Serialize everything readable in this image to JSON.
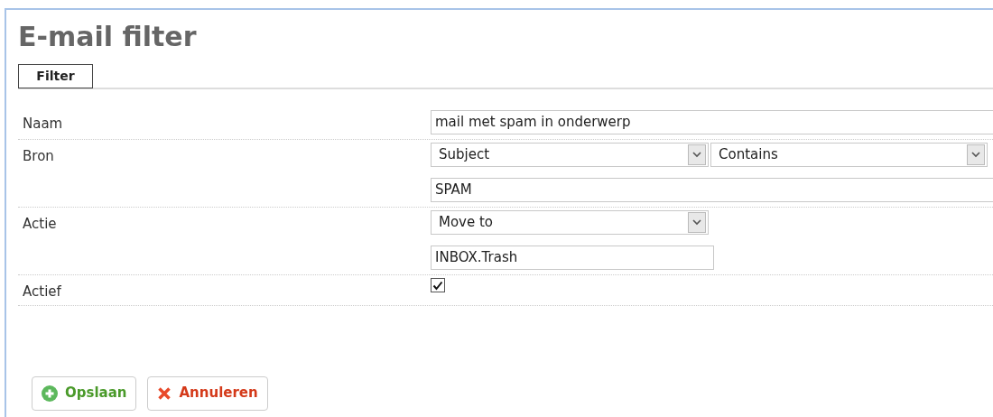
{
  "title": "E-mail filter",
  "tabs": [
    {
      "label": "Filter",
      "selected": true
    }
  ],
  "rows": [
    {
      "label": "Naam",
      "controls": [
        {
          "kind": "input",
          "value": "mail met spam in onderwerp"
        }
      ]
    },
    {
      "label": "Bron",
      "controls": [
        {
          "kind": "select-pair",
          "values": [
            "Subject",
            "Contains"
          ]
        },
        {
          "kind": "input",
          "value": "SPAM"
        }
      ]
    },
    {
      "label": "Actie",
      "controls": [
        {
          "kind": "select",
          "value": "Move to"
        },
        {
          "kind": "short-input",
          "value": "INBOX.Trash"
        }
      ]
    },
    {
      "label": "Actief",
      "controls": [
        {
          "kind": "checkbox",
          "checked": true
        }
      ]
    }
  ],
  "buttons": [
    {
      "kind": "save",
      "label": "Opslaan"
    },
    {
      "kind": "cancel",
      "label": "Annuleren"
    }
  ]
}
